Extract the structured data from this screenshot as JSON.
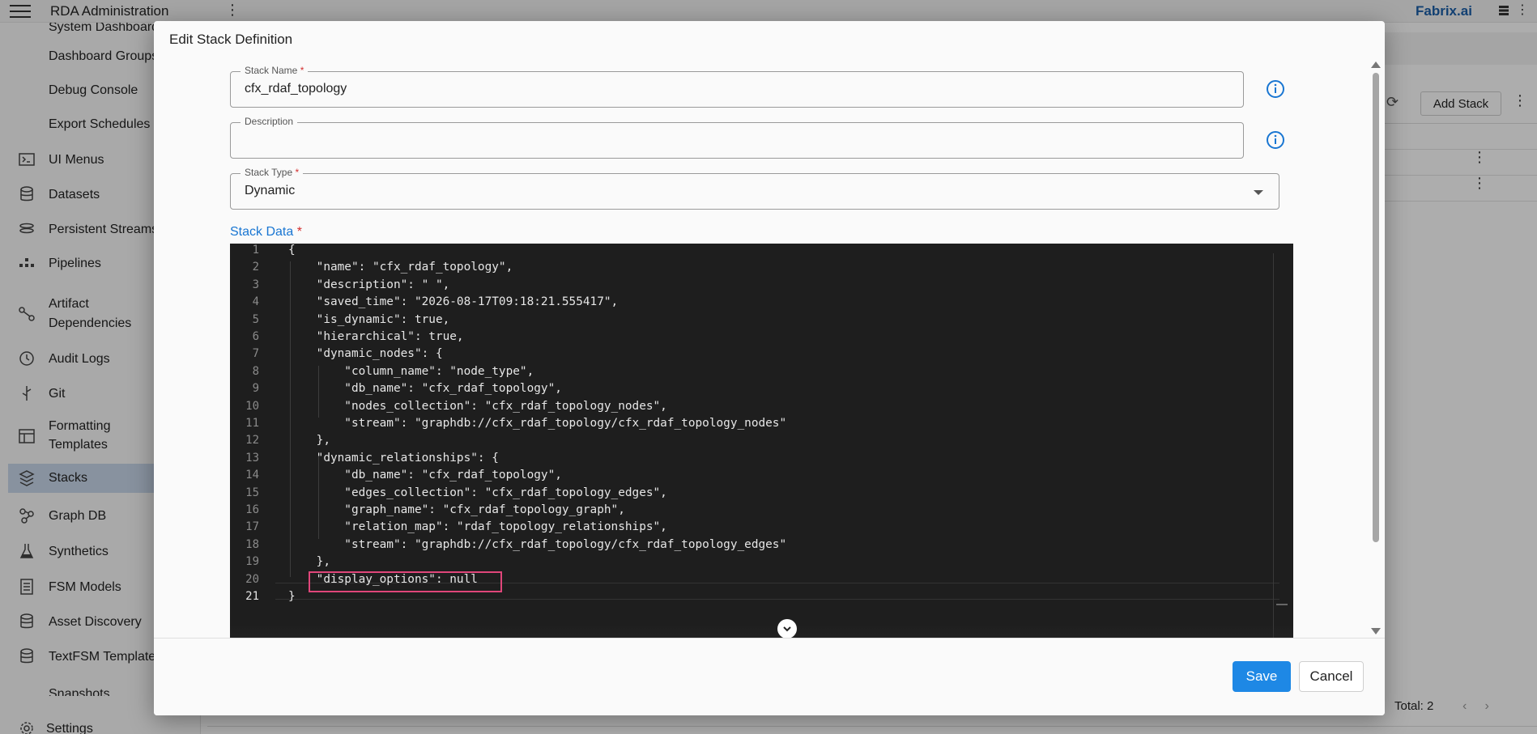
{
  "app": {
    "title": "RDA Administration",
    "brand": "Fabrix.ai"
  },
  "sidebar": {
    "items": [
      {
        "label": "System Dashboard",
        "icon": "none"
      },
      {
        "label": "Dashboard Groups",
        "icon": "none"
      },
      {
        "label": "Debug Console",
        "icon": "none"
      },
      {
        "label": "Export Schedules",
        "icon": "none"
      },
      {
        "label": "UI Menus",
        "icon": "terminal-icon"
      },
      {
        "label": "Datasets",
        "icon": "database-icon"
      },
      {
        "label": "Persistent Streams",
        "icon": "stream-icon"
      },
      {
        "label": "Pipelines",
        "icon": "pipeline-icon"
      },
      {
        "label": "Artifact",
        "label2": "Dependencies",
        "icon": "dependency-icon"
      },
      {
        "label": "Audit Logs",
        "icon": "history-icon"
      },
      {
        "label": "Git",
        "icon": "git-icon"
      },
      {
        "label": "Formatting",
        "label2": "Templates",
        "icon": "template-icon"
      },
      {
        "label": "Stacks",
        "icon": "stacks-icon",
        "active": true
      },
      {
        "label": "Graph DB",
        "icon": "graph-icon"
      },
      {
        "label": "Synthetics",
        "icon": "flask-icon"
      },
      {
        "label": "FSM Models",
        "icon": "document-icon"
      },
      {
        "label": "Asset Discovery",
        "icon": "database-icon"
      },
      {
        "label": "TextFSM Template",
        "icon": "database-icon"
      },
      {
        "label": "Snapshots",
        "icon": "snapshot-icon"
      },
      {
        "label": "Settings",
        "icon": "gear-icon"
      }
    ]
  },
  "background": {
    "add_stack_label": "Add Stack",
    "footer_total": "Total: 2"
  },
  "dialog": {
    "title": "Edit Stack Definition",
    "stack_name": {
      "label": "Stack Name",
      "required": "*",
      "value": "cfx_rdaf_topology"
    },
    "description": {
      "label": "Description",
      "value": ""
    },
    "stack_type": {
      "label": "Stack Type",
      "required": "*",
      "value": "Dynamic"
    },
    "stack_data_label": "Stack Data",
    "stack_data_required": "*",
    "code_lines": [
      "{",
      "    \"name\": \"cfx_rdaf_topology\",",
      "    \"description\": \" \",",
      "    \"saved_time\": \"2026-08-17T09:18:21.555417\",",
      "    \"is_dynamic\": true,",
      "    \"hierarchical\": true,",
      "    \"dynamic_nodes\": {",
      "        \"column_name\": \"node_type\",",
      "        \"db_name\": \"cfx_rdaf_topology\",",
      "        \"nodes_collection\": \"cfx_rdaf_topology_nodes\",",
      "        \"stream\": \"graphdb://cfx_rdaf_topology/cfx_rdaf_topology_nodes\"",
      "    },",
      "    \"dynamic_relationships\": {",
      "        \"db_name\": \"cfx_rdaf_topology\",",
      "        \"edges_collection\": \"cfx_rdaf_topology_edges\",",
      "        \"graph_name\": \"cfx_rdaf_topology_graph\",",
      "        \"relation_map\": \"rdaf_topology_relationships\",",
      "        \"stream\": \"graphdb://cfx_rdaf_topology/cfx_rdaf_topology_edges\"",
      "    },",
      "    \"display_options\": null",
      "}"
    ],
    "line_numbers": [
      "1",
      "2",
      "3",
      "4",
      "5",
      "6",
      "7",
      "8",
      "9",
      "10",
      "11",
      "12",
      "13",
      "14",
      "15",
      "16",
      "17",
      "18",
      "19",
      "20",
      "21"
    ],
    "save_label": "Save",
    "cancel_label": "Cancel"
  },
  "colors": {
    "accent": "#1e88e5",
    "highlight": "#e0467a",
    "editor_bg": "#1e1e1e"
  }
}
